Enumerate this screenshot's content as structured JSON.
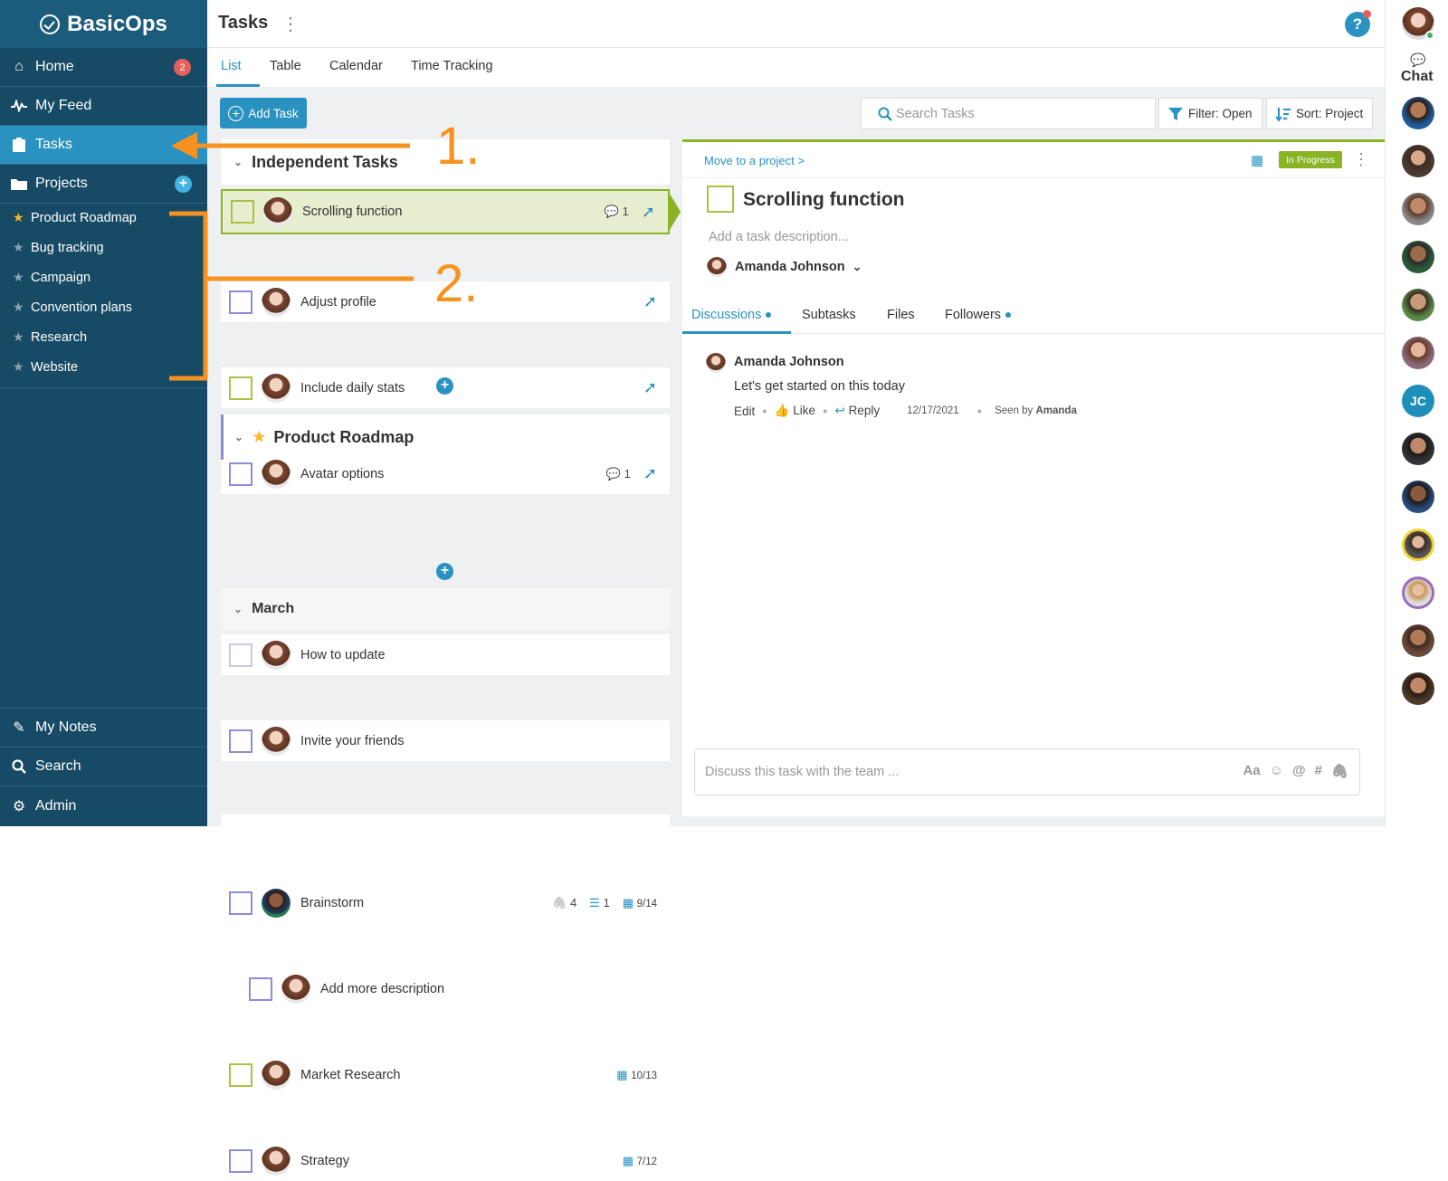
{
  "app": {
    "logo": "BasicOps"
  },
  "sidebar": {
    "nav_top": [
      {
        "label": "Home",
        "icon": "home-icon",
        "badge": "2"
      },
      {
        "label": "My Feed",
        "icon": "pulse-icon"
      },
      {
        "label": "Tasks",
        "icon": "clipboard-icon",
        "active": true
      },
      {
        "label": "Projects",
        "icon": "folder-icon"
      }
    ],
    "projects": [
      {
        "label": "Product Roadmap",
        "starred": true
      },
      {
        "label": "Bug tracking"
      },
      {
        "label": "Campaign"
      },
      {
        "label": "Convention plans"
      },
      {
        "label": "Research"
      },
      {
        "label": "Website"
      }
    ],
    "nav_bottom": [
      {
        "label": "My Notes",
        "icon": "pencil-icon"
      },
      {
        "label": "Search",
        "icon": "search-icon"
      },
      {
        "label": "Admin",
        "icon": "gear-icon"
      }
    ]
  },
  "header": {
    "title": "Tasks"
  },
  "tabs": [
    "List",
    "Table",
    "Calendar",
    "Time Tracking"
  ],
  "toolbar": {
    "add_task": "Add Task",
    "search_placeholder": "Search Tasks",
    "filter": "Filter: Open",
    "sort": "Sort: Project"
  },
  "groups": {
    "independent": {
      "title": "Independent Tasks",
      "tasks": [
        {
          "title": "Scrolling function",
          "comments": "1"
        },
        {
          "title": "Adjust profile"
        },
        {
          "title": "Include daily stats"
        },
        {
          "title": "Avatar options",
          "comments": "1"
        }
      ]
    },
    "roadmap": {
      "title": "Product Roadmap",
      "tasks": [
        {
          "title": "How to update"
        },
        {
          "title": "Invite your friends"
        }
      ]
    },
    "march": {
      "title": "March",
      "tasks": [
        {
          "title": "Brainstorm",
          "attachments": "4",
          "subtasks": "1",
          "due": "9/14"
        },
        {
          "title": "Add more description"
        },
        {
          "title": "Market Research",
          "due": "10/13"
        },
        {
          "title": "Strategy",
          "due": "7/12"
        }
      ]
    }
  },
  "detail": {
    "move_link": "Move to a project >",
    "status": "In Progress",
    "title": "Scrolling function",
    "description_placeholder": "Add a task description...",
    "assignee": "Amanda Johnson",
    "tabs": [
      "Discussions",
      "Subtasks",
      "Files",
      "Followers"
    ],
    "comment": {
      "author": "Amanda Johnson",
      "text": "Let's get started on this today",
      "edit": "Edit",
      "like": "Like",
      "reply": "Reply",
      "date": "12/17/2021",
      "seen_prefix": "Seen by",
      "seen_by": "Amanda"
    },
    "discuss_placeholder": "Discuss this task with the team ...",
    "composer_icons": [
      "Aa",
      "☺",
      "@",
      "#"
    ]
  },
  "chat": {
    "label": "Chat",
    "initials": "JC"
  },
  "annotations": [
    "1.",
    "2."
  ],
  "colors": {
    "sidebar": "#174a64",
    "accent": "#2a92c0",
    "green": "#8ab326",
    "annotation": "#f7921e"
  }
}
